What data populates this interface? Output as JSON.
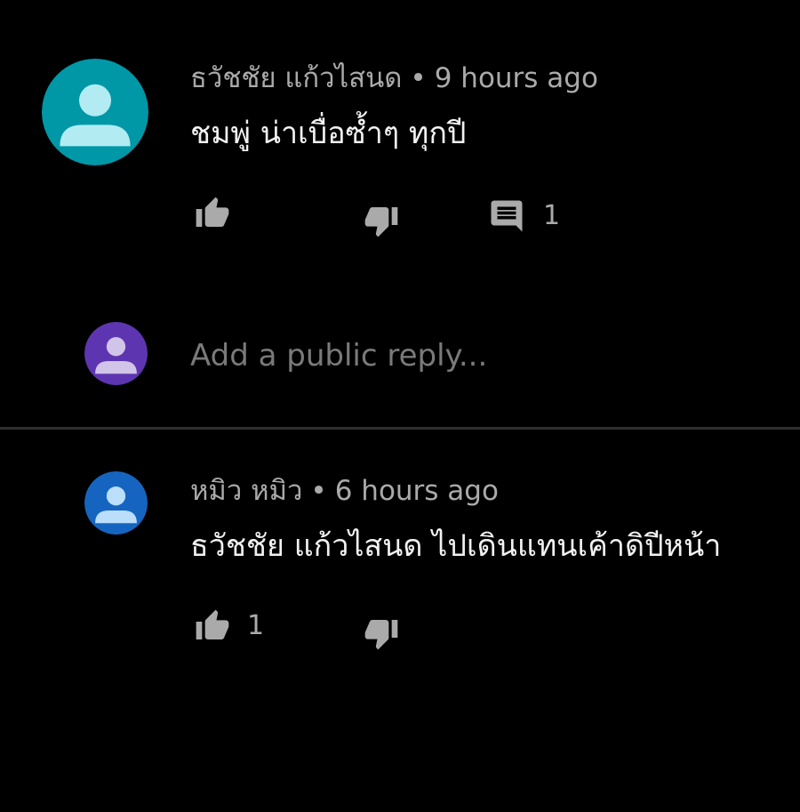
{
  "colors": {
    "background": "#000000",
    "text_primary": "#f1f1f1",
    "text_secondary": "#aaaaaa",
    "placeholder": "#7a7a7a",
    "divider": "#2e2e2e",
    "avatar_teal": "#0097a7",
    "avatar_purple": "#5e35b1",
    "avatar_blue": "#1565c0"
  },
  "comment_1": {
    "author": "ธวัชชัย แก้วไสนด",
    "separator": "•",
    "time": "9 hours ago",
    "text": "ชมพู่ น่าเบื่อซ้ำๆ ทุกปี",
    "like_icon": "thumb-up-icon",
    "dislike_icon": "thumb-down-icon",
    "reply_icon": "comment-icon",
    "reply_count": "1"
  },
  "reply_box": {
    "avatar_icon": "person-icon",
    "placeholder": "Add a public reply..."
  },
  "comment_2": {
    "author": "หมิว หมิว",
    "separator": "•",
    "time": "6 hours ago",
    "text": "ธวัชชัย แก้วไสนด ไปเดินแทนเค้าดิปีหน้า",
    "like_icon": "thumb-up-icon",
    "like_count": "1",
    "dislike_icon": "thumb-down-icon"
  }
}
